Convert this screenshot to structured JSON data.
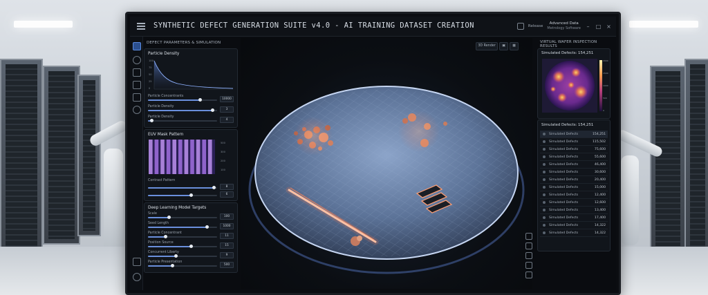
{
  "window": {
    "title": "SYNTHETIC DEFECT GENERATION SUITE v4.0 - AI TRAINING DATASET CREATION",
    "release_label": "Release",
    "user_name": "Advanced Data",
    "user_role": "Metrology Software"
  },
  "left_panel": {
    "header": "DEFECT PARAMETERS & SIMULATION CONTROLS",
    "particle_density": {
      "title": "Particle Density",
      "chart_y_ticks": [
        "100",
        "75",
        "50",
        "25",
        "0"
      ],
      "sliders": [
        {
          "label": "Particle Concentrants",
          "value": "10000",
          "level": 0.75
        },
        {
          "label": "Particle Density",
          "value": "3",
          "level": 0.93
        },
        {
          "label": "Particle Density",
          "value": "4",
          "level": 0.05
        }
      ]
    },
    "euv_mask": {
      "title": "EUV Mask Pattern",
      "stripes": 11,
      "scale_ticks": [
        "500",
        "300",
        "200",
        "100"
      ],
      "pattern_label": "Contrast Pattern",
      "sliders": [
        {
          "label": "",
          "value": "8",
          "level": 0.95
        },
        {
          "label": "",
          "value": "6",
          "level": 0.62
        }
      ]
    },
    "dl_targets": {
      "title": "Deep Learning Model Targets",
      "sliders": [
        {
          "label": "Scale",
          "value": "100",
          "level": 0.3
        },
        {
          "label": "Seed Length",
          "value": "1000",
          "level": 0.85
        },
        {
          "label": "Particle Concentrant",
          "value": "11",
          "level": 0.25
        },
        {
          "label": "Position Source",
          "value": "15",
          "level": 0.62
        },
        {
          "label": "Concurrent Liberty",
          "value": "9",
          "level": 0.4
        },
        {
          "label": "Particle Presentation",
          "value": "500",
          "level": 0.35
        }
      ]
    }
  },
  "viewport": {
    "toolbar_button": "3D Render",
    "colors": {
      "wafer_edge": "#b9d1ff",
      "defect_glow": "#ff9a6a"
    }
  },
  "right_panel": {
    "header": "VIRTUAL WAFER INSPECTION RESULTS",
    "heatmap_title": "Simulated Defects: 154,251",
    "heatmap_scale": [
      "2000",
      "1500",
      "1000",
      "500",
      "0"
    ],
    "results_title": "Simulated Defects: 154,251",
    "rows": [
      {
        "name": "Simulated Defects",
        "value": "154,251"
      },
      {
        "name": "Simulated Defects",
        "value": "115,502"
      },
      {
        "name": "Simulated Defects",
        "value": "75,600"
      },
      {
        "name": "Simulated Defects",
        "value": "55,600"
      },
      {
        "name": "Simulated Defects",
        "value": "46,400"
      },
      {
        "name": "Simulated Defects",
        "value": "30,600"
      },
      {
        "name": "Simulated Defects",
        "value": "20,400"
      },
      {
        "name": "Simulated Defects",
        "value": "15,000"
      },
      {
        "name": "Simulated Defects",
        "value": "12,400"
      },
      {
        "name": "Simulated Defects",
        "value": "12,600"
      },
      {
        "name": "Simulated Defects",
        "value": "13,400"
      },
      {
        "name": "Simulated Defects",
        "value": "17,400"
      },
      {
        "name": "Simulated Defects",
        "value": "14,322"
      },
      {
        "name": "Simulated Defects",
        "value": "14,322"
      }
    ]
  }
}
